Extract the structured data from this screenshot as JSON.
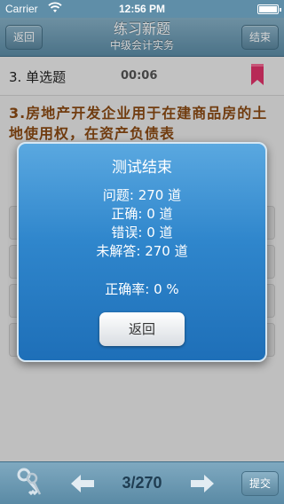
{
  "status_bar": {
    "carrier": "Carrier",
    "time": "12:56 PM"
  },
  "nav": {
    "back_label": "返回",
    "title": "练习新题",
    "subtitle": "中级会计实务",
    "end_label": "结束"
  },
  "question": {
    "type_label": "3. 单选题",
    "timer": "00:06",
    "text": "3.房地产开发企业用于在建商品房的土地使用权，在资产负债表"
  },
  "modal": {
    "title": "测试结束",
    "questions": "问题: 270 道",
    "correct": "正确:  0 道",
    "wrong": "错误:  0 道",
    "unanswered": "未解答:   270 道",
    "accuracy": "正确率: 0 %",
    "back_label": "返回"
  },
  "toolbar": {
    "page": "3/270",
    "submit_label": "提交"
  },
  "icons": {
    "wifi": "wifi-icon",
    "battery": "battery-icon",
    "bookmark": "bookmark-icon",
    "keys": "keys-icon",
    "prev": "arrow-left-icon",
    "next": "arrow-right-icon"
  },
  "colors": {
    "bookmark": "#e0336a",
    "question_text": "#8a4a13",
    "modal_blue": "#2f86cc"
  }
}
